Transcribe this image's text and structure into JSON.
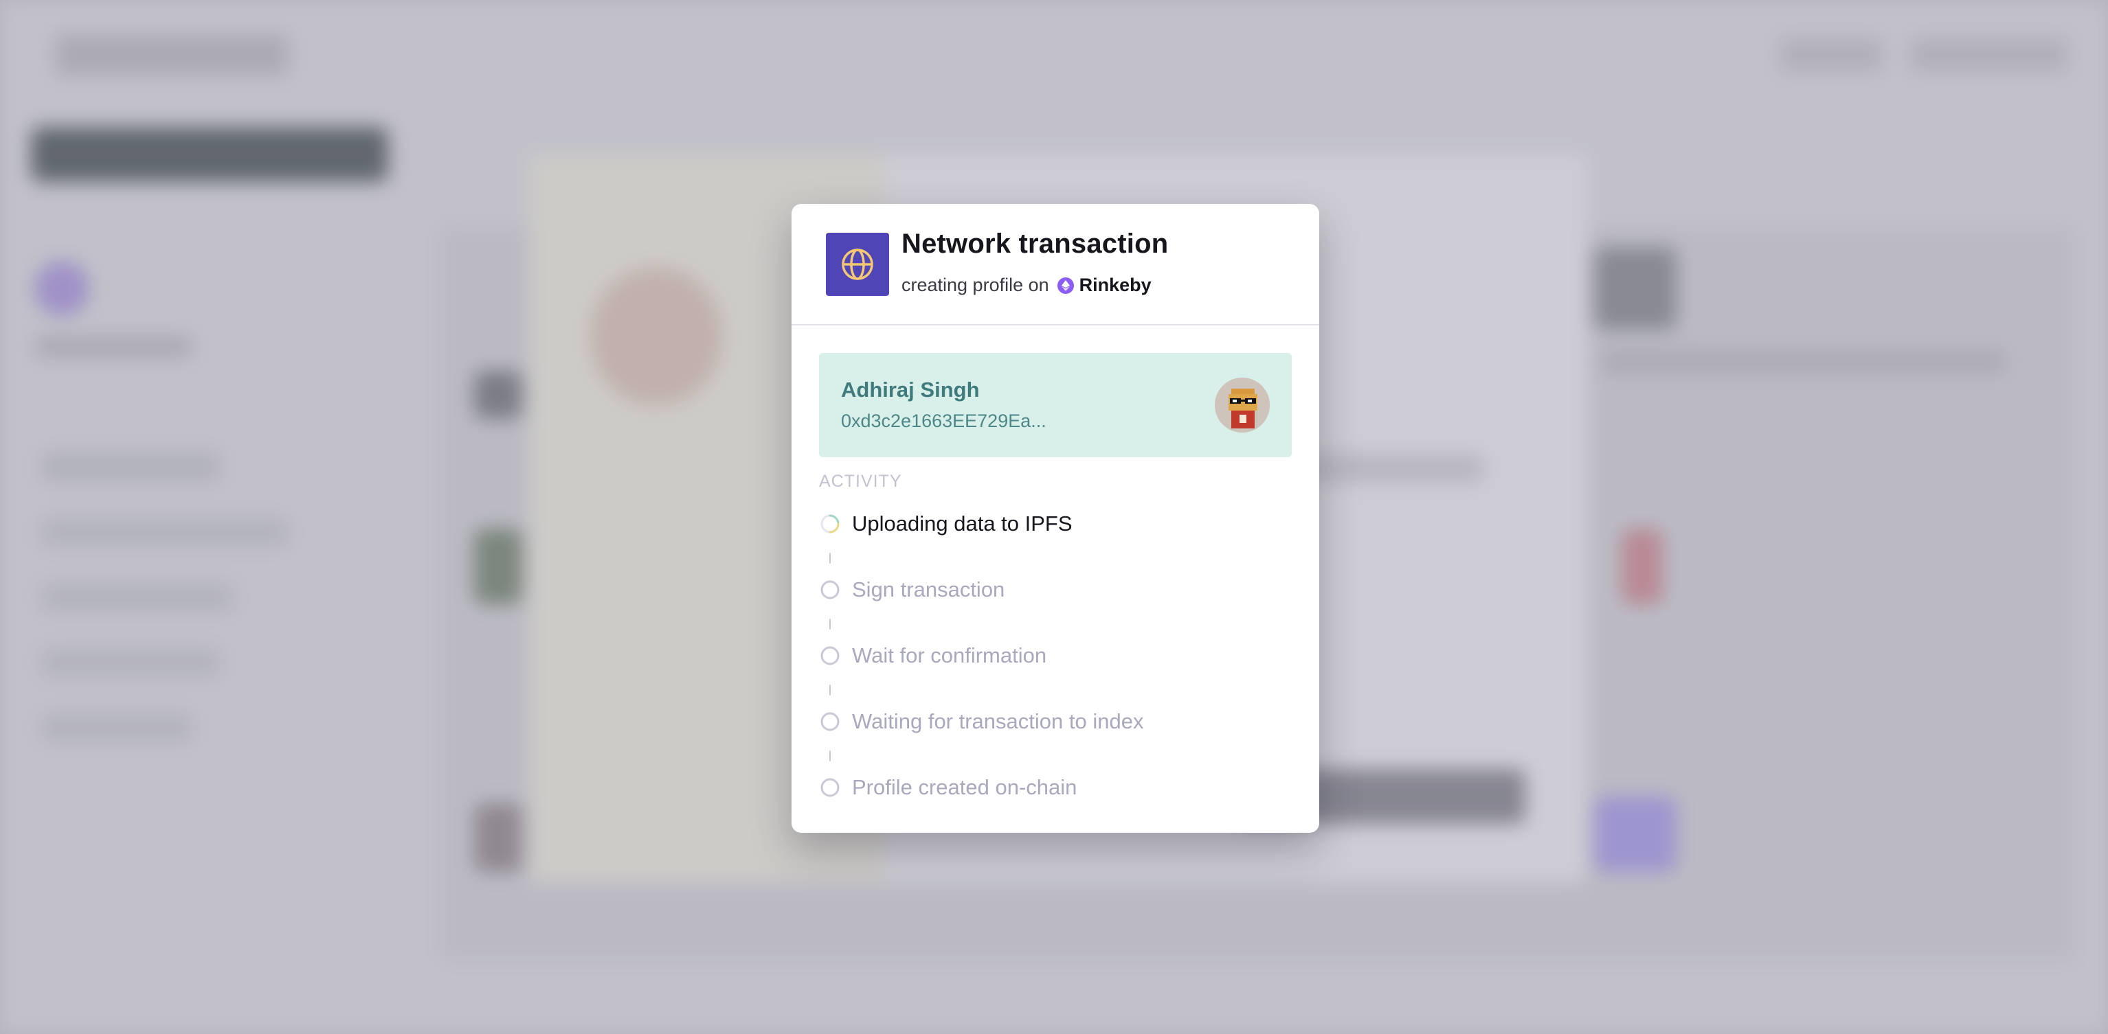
{
  "modal": {
    "title": "Network transaction",
    "subtitle_prefix": "creating profile on",
    "network_name": "Rinkeby",
    "icon": "globe-icon",
    "accent_color": "#4f45b6"
  },
  "account": {
    "name": "Adhiraj Singh",
    "address": "0xd3c2e1663EE729Ea...",
    "avatar": "pixel-avatar"
  },
  "activity": {
    "label": "ACTIVITY",
    "steps": [
      {
        "label": "Uploading data to IPFS",
        "status": "in-progress"
      },
      {
        "label": "Sign transaction",
        "status": "pending"
      },
      {
        "label": "Wait for confirmation",
        "status": "pending"
      },
      {
        "label": "Waiting for transaction to index",
        "status": "pending"
      },
      {
        "label": "Profile created on-chain",
        "status": "pending"
      }
    ]
  }
}
